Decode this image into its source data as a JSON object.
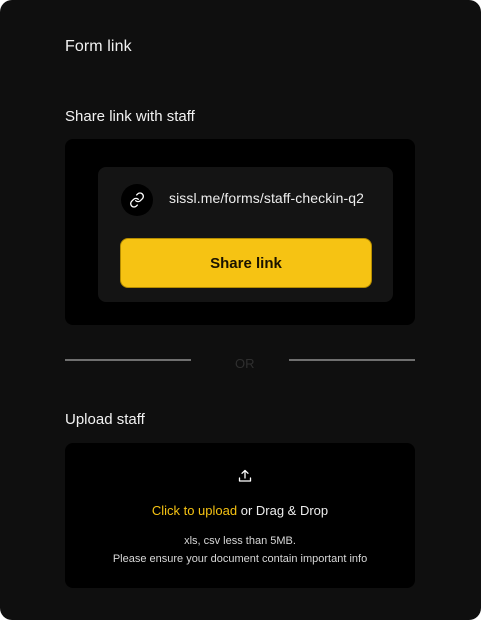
{
  "header": {
    "title": "Form link"
  },
  "share": {
    "heading": "Share link with staff",
    "link_icon": "link-icon",
    "url": "sissl.me/forms/staff-checkin-q2",
    "button_label": "Share link"
  },
  "divider": {
    "label": "OR"
  },
  "upload": {
    "heading": "Upload staff",
    "icon": "upload-icon",
    "click_label": "Click to upload",
    "drag_label": " or Drag & Drop",
    "hint_formats": "xls, csv less than 5MB.",
    "hint_info": "Please ensure your document contain important info"
  },
  "colors": {
    "panel_background": "#0f0f0f",
    "accent": "#f6c313",
    "accent_border": "#b58c00"
  }
}
